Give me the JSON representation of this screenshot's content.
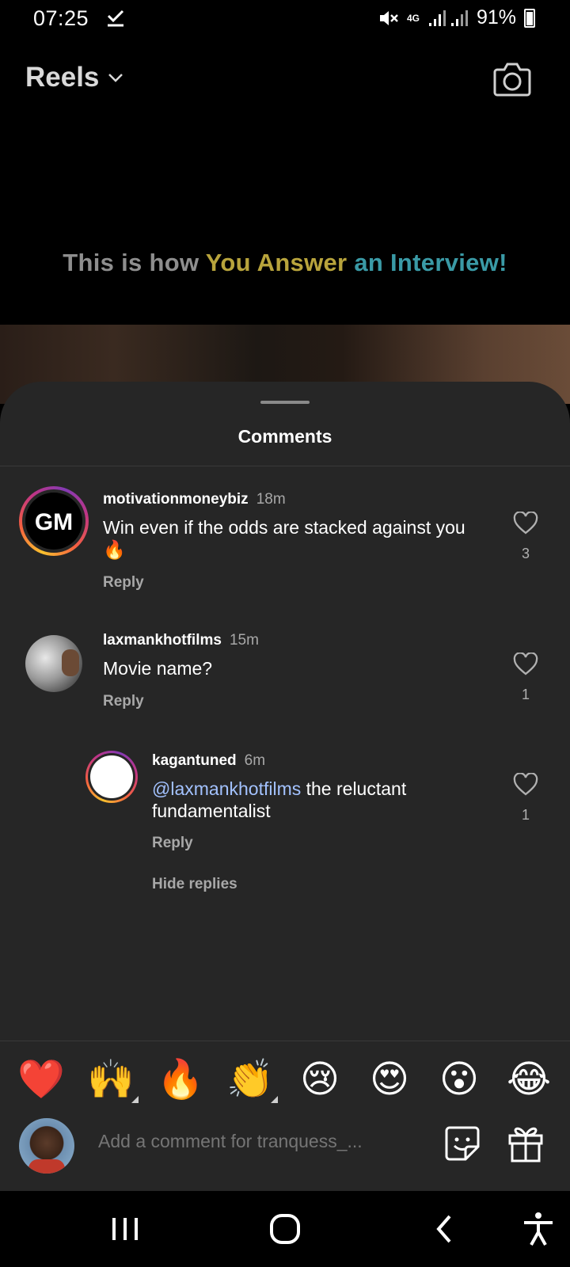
{
  "status_bar": {
    "time": "07:25",
    "network": "4G",
    "battery": "91%"
  },
  "header": {
    "title": "Reels"
  },
  "video": {
    "caption_part1": "This is how ",
    "caption_part2": "You Answer ",
    "caption_part3": "an Interview!"
  },
  "comments_sheet": {
    "title": "Comments",
    "comments": [
      {
        "username": "motivationmoneybiz",
        "time": "18m",
        "text": "Win even if the odds are stacked against you 🔥",
        "reply_label": "Reply",
        "likes": "3"
      },
      {
        "username": "laxmankhotfilms",
        "time": "15m",
        "text": "Movie name?",
        "reply_label": "Reply",
        "likes": "1"
      },
      {
        "username": "kagantuned",
        "time": "6m",
        "mention": "@laxmankhotfilms",
        "text": " the reluctant fundamentalist",
        "reply_label": "Reply",
        "likes": "1"
      }
    ],
    "hide_replies_label": "Hide replies"
  },
  "emoji_bar": {
    "emojis": [
      "❤️",
      "🙌",
      "🔥",
      "👏",
      "😢",
      "😍",
      "😮",
      "😂"
    ]
  },
  "comment_input": {
    "placeholder": "Add a comment for tranquess_..."
  },
  "colors": {
    "sheet_bg": "#262626",
    "caption_gray": "#8e8e8e",
    "caption_yellow": "#b8a43c",
    "caption_teal": "#3a9aa6",
    "heart_red": "#ed2a3a"
  }
}
